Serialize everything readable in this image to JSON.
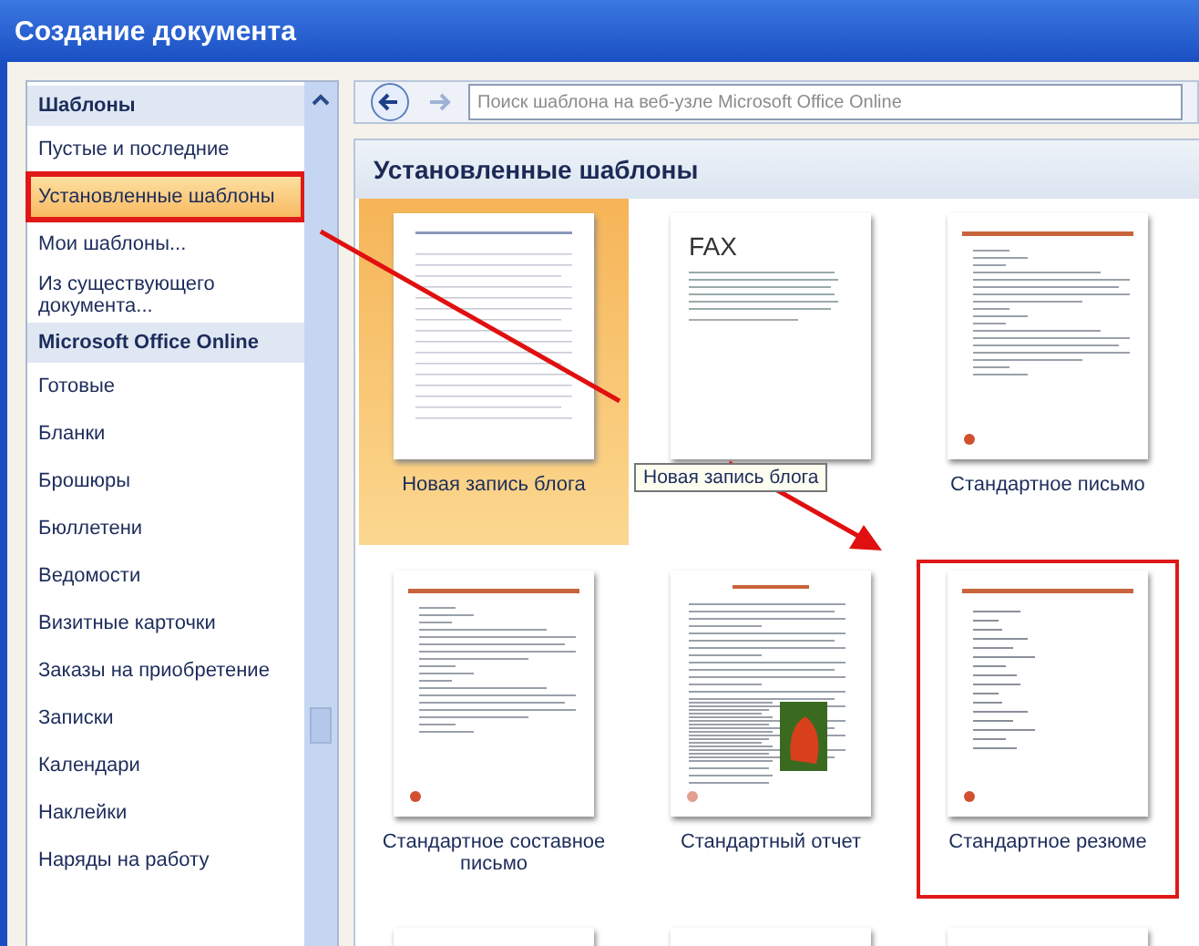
{
  "window": {
    "title": "Создание документа"
  },
  "sidebar": {
    "items": [
      {
        "kind": "section",
        "label": "Шаблоны"
      },
      {
        "kind": "item",
        "label": "Пустые и последние",
        "selected": false
      },
      {
        "kind": "item",
        "label": "Установленные шаблоны",
        "selected": true
      },
      {
        "kind": "item",
        "label": "Мои шаблоны...",
        "selected": false
      },
      {
        "kind": "item",
        "label": "Из существующего документа...",
        "selected": false
      },
      {
        "kind": "section",
        "label": "Microsoft Office Online"
      },
      {
        "kind": "item",
        "label": "Готовые",
        "selected": false
      },
      {
        "kind": "item",
        "label": "Бланки",
        "selected": false
      },
      {
        "kind": "item",
        "label": "Брошюры",
        "selected": false
      },
      {
        "kind": "item",
        "label": "Бюллетени",
        "selected": false
      },
      {
        "kind": "item",
        "label": "Ведомости",
        "selected": false
      },
      {
        "kind": "item",
        "label": "Визитные карточки",
        "selected": false
      },
      {
        "kind": "item",
        "label": "Заказы на приобретение",
        "selected": false
      },
      {
        "kind": "item",
        "label": "Записки",
        "selected": false
      },
      {
        "kind": "item",
        "label": "Календари",
        "selected": false
      },
      {
        "kind": "item",
        "label": "Наклейки",
        "selected": false
      },
      {
        "kind": "item",
        "label": "Наряды на работу",
        "selected": false
      }
    ]
  },
  "search": {
    "placeholder": "Поиск шаблона на веб-узле Microsoft Office Online"
  },
  "section_title": "Установленные шаблоны",
  "templates": [
    {
      "kind": "blog",
      "label": "Новая запись блога",
      "selected": true
    },
    {
      "kind": "fax",
      "thumb_text": "FAX",
      "selected": false
    },
    {
      "kind": "letter",
      "label": "Стандартное письмо",
      "selected": false
    },
    {
      "kind": "letter",
      "label": "Стандартное составное письмо",
      "selected": false
    },
    {
      "kind": "report",
      "label": "Стандартный отчет",
      "selected": false
    },
    {
      "kind": "resume",
      "label": "Стандартное резюме",
      "selected": false,
      "highlighted": true
    },
    {
      "kind": "blank",
      "selected": false
    },
    {
      "kind": "blank",
      "selected": false
    },
    {
      "kind": "blank",
      "selected": false
    }
  ],
  "tooltip": "Новая запись блога"
}
